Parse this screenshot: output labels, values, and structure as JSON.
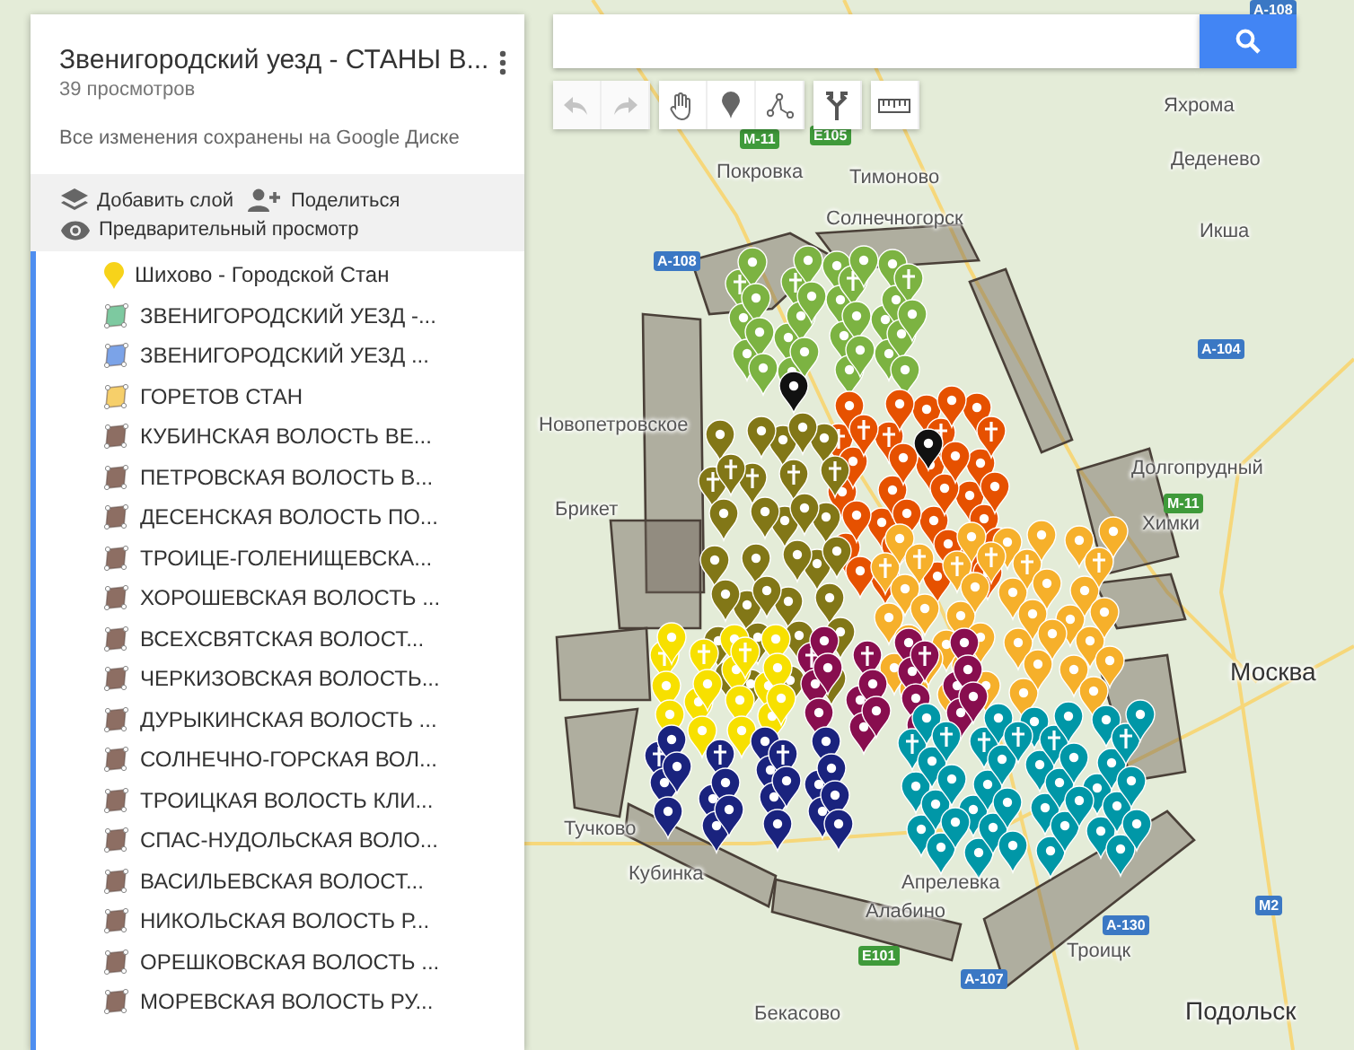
{
  "sidebar": {
    "title": "Звенигородский уезд - СТАНЫ В...",
    "views": "39 просмотров",
    "saved_status": "Все изменения сохранены на Google Диске",
    "actions": [
      {
        "kind": "add-layer",
        "label": "Добавить слой"
      },
      {
        "kind": "share",
        "label": "Поделиться"
      },
      {
        "kind": "preview",
        "label": "Предварительный просмотр"
      }
    ],
    "layers": [
      {
        "kind": "pin",
        "label": "Шихово - Городской Стан",
        "color": "#f7d31a"
      },
      {
        "kind": "polygon",
        "label": "ЗВЕНИГОРОДСКИЙ УЕЗД -...",
        "color": "#7dc9a0"
      },
      {
        "kind": "polygon",
        "label": "ЗВЕНИГОРОДСКИЙ УЕЗД  ...",
        "color": "#7ba3e8"
      },
      {
        "kind": "polygon",
        "label": "ГОРЕТОВ СТАН",
        "color": "#f6cf6a"
      },
      {
        "kind": "polygon",
        "label": "КУБИНСКАЯ ВОЛОСТЬ ВЕ...",
        "color": "#8d6e63"
      },
      {
        "kind": "polygon",
        "label": "ПЕТРОВСКАЯ ВОЛОСТЬ В...",
        "color": "#8d6e63"
      },
      {
        "kind": "polygon",
        "label": "ДЕСЕНСКАЯ ВОЛОСТЬ ПО...",
        "color": "#8d6e63"
      },
      {
        "kind": "polygon",
        "label": "ТРОИЦЕ-ГОЛЕНИЩЕВСКА...",
        "color": "#8d6e63"
      },
      {
        "kind": "polygon",
        "label": "ХОРОШЕВСКАЯ ВОЛОСТЬ ...",
        "color": "#8d6e63"
      },
      {
        "kind": "polygon",
        "label": "ВСЕХСВЯТСКАЯ ВОЛОСТ...",
        "color": "#8d6e63"
      },
      {
        "kind": "polygon",
        "label": "ЧЕРКИЗОВСКАЯ ВОЛОСТЬ...",
        "color": "#8d6e63"
      },
      {
        "kind": "polygon",
        "label": "ДУРЫКИНСКАЯ ВОЛОСТЬ ...",
        "color": "#8d6e63"
      },
      {
        "kind": "polygon",
        "label": "СОЛНЕЧНО-ГОРСКАЯ ВОЛ...",
        "color": "#8d6e63"
      },
      {
        "kind": "polygon",
        "label": "ТРОИЦКАЯ ВОЛОСТЬ КЛИ...",
        "color": "#8d6e63"
      },
      {
        "kind": "polygon",
        "label": "СПАС-НУДОЛЬСКАЯ ВОЛО...",
        "color": "#8d6e63"
      },
      {
        "kind": "polygon",
        "label": "ВАСИЛЬЕВСКАЯ ВОЛОСТ...",
        "color": "#8d6e63"
      },
      {
        "kind": "polygon",
        "label": "НИКОЛЬСКАЯ ВОЛОСТЬ Р...",
        "color": "#8d6e63"
      },
      {
        "kind": "polygon",
        "label": "ОРЕШКОВСКАЯ ВОЛОСТЬ ...",
        "color": "#8d6e63"
      },
      {
        "kind": "polygon",
        "label": "МОРЕВСКАЯ ВОЛОСТЬ РУ...",
        "color": "#8d6e63"
      }
    ]
  },
  "toolbar": [
    {
      "kind": "undo",
      "disabled": true
    },
    {
      "kind": "redo",
      "disabled": true
    },
    {
      "kind": "hand",
      "disabled": false
    },
    {
      "kind": "marker",
      "disabled": false
    },
    {
      "kind": "line",
      "disabled": false
    },
    {
      "kind": "directions",
      "disabled": false
    },
    {
      "kind": "ruler",
      "disabled": false
    }
  ],
  "map": {
    "labels": [
      {
        "kind": "place",
        "text": "Яхрома"
      },
      {
        "kind": "place",
        "text": "Деденево"
      },
      {
        "kind": "place",
        "text": "Икша"
      },
      {
        "kind": "place",
        "text": "Покровка"
      },
      {
        "kind": "place",
        "text": "Тимоново"
      },
      {
        "kind": "place",
        "text": "Солнечногорск"
      },
      {
        "kind": "place",
        "text": "Новопетровское"
      },
      {
        "kind": "place",
        "text": "Брикет"
      },
      {
        "kind": "place",
        "text": "Долгопрудный"
      },
      {
        "kind": "place",
        "text": "Химки"
      },
      {
        "kind": "place",
        "text": "Москва"
      },
      {
        "kind": "place",
        "text": "Тучково"
      },
      {
        "kind": "place",
        "text": "Кубинка"
      },
      {
        "kind": "place",
        "text": "Апрелевка"
      },
      {
        "kind": "place",
        "text": "Алабино"
      },
      {
        "kind": "place",
        "text": "Троицк"
      },
      {
        "kind": "place",
        "text": "Подольск"
      },
      {
        "kind": "place",
        "text": "Бекасово"
      },
      {
        "kind": "road",
        "text": "M-11",
        "color": "#3f9a3a"
      },
      {
        "kind": "road",
        "text": "E105",
        "color": "#3f9a3a"
      },
      {
        "kind": "road",
        "text": "A-108",
        "color": "#3b78c4"
      },
      {
        "kind": "road",
        "text": "A-108",
        "color": "#3b78c4"
      },
      {
        "kind": "road",
        "text": "A-104",
        "color": "#3b78c4"
      },
      {
        "kind": "road",
        "text": "M-11",
        "color": "#3f9a3a"
      },
      {
        "kind": "road",
        "text": "E101",
        "color": "#3f9a3a"
      },
      {
        "kind": "road",
        "text": "A-107",
        "color": "#3b78c4"
      },
      {
        "kind": "road",
        "text": "A-130",
        "color": "#3b78c4"
      },
      {
        "kind": "road",
        "text": "M2",
        "color": "#3b78c4"
      }
    ]
  }
}
